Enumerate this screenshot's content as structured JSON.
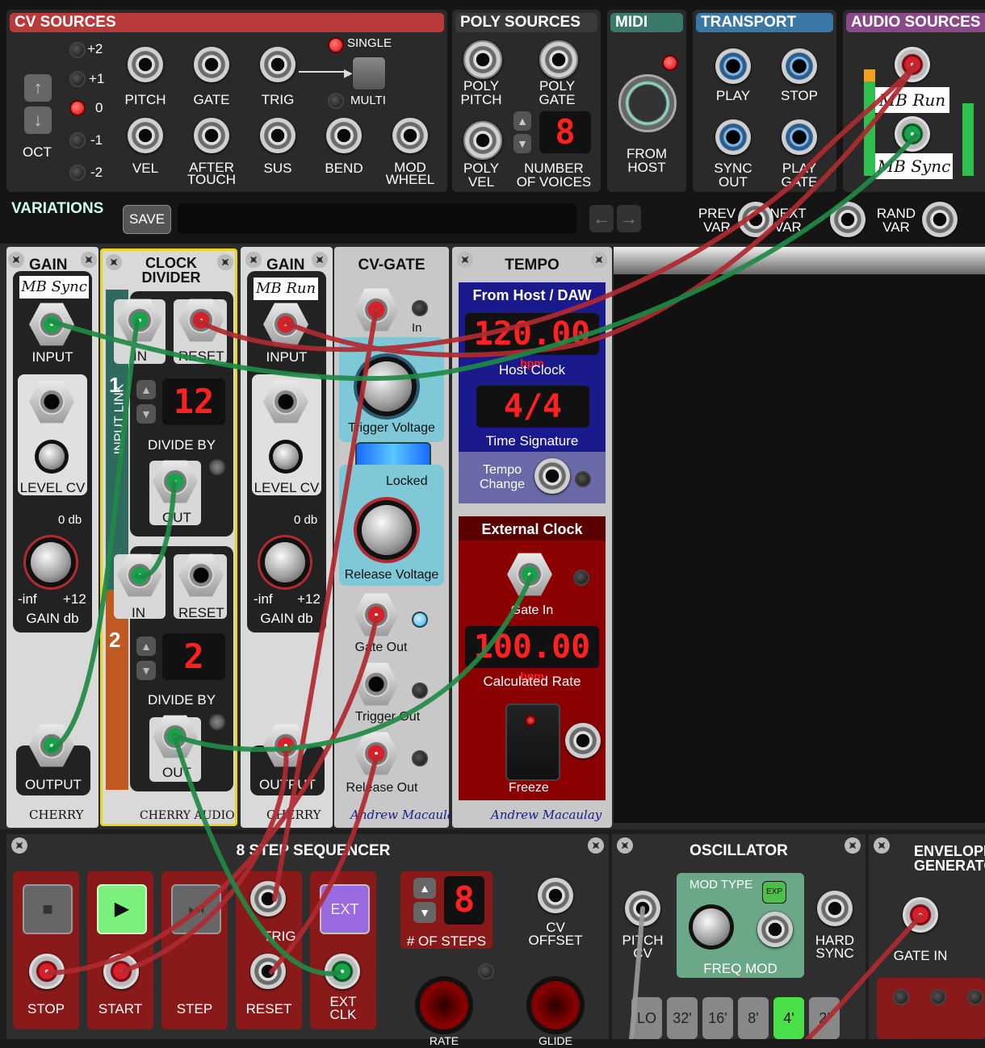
{
  "top_bar": {
    "cv_sources": {
      "title": "CV SOURCES",
      "oct_label": "OCT",
      "oct_levels": [
        "+2",
        "+1",
        "0",
        "-1",
        "-2"
      ],
      "jacks_row1": [
        "PITCH",
        "GATE",
        "TRIG"
      ],
      "jacks_row2": [
        "VEL",
        "AFTER\nTOUCH",
        "SUS",
        "BEND",
        "MOD\nWHEEL"
      ],
      "single_label": "SINGLE",
      "multi_label": "MULTI"
    },
    "poly_sources": {
      "title": "POLY SOURCES",
      "poly_pitch": "POLY\nPITCH",
      "poly_gate": "POLY\nGATE",
      "poly_vel": "POLY\nVEL",
      "voices_label": "NUMBER\nOF VOICES",
      "voices_value": "8"
    },
    "midi": {
      "title": "MIDI",
      "from_host": "FROM\nHOST"
    },
    "transport": {
      "title": "TRANSPORT",
      "play": "PLAY",
      "stop": "STOP",
      "sync_out": "SYNC\nOUT",
      "play_gate": "PLAY\nGATE"
    },
    "audio_sources": {
      "title": "AUDIO SOURCES",
      "tag1": "MB Run",
      "tag2": "MB Sync"
    },
    "variations": {
      "title": "VARIATIONS",
      "save_label": "SAVE",
      "prev": "PREV\nVAR",
      "next": "NEXT\nVAR",
      "rand": "RAND\nVAR"
    }
  },
  "gain1": {
    "title": "GAIN",
    "tag": "MB Sync",
    "input": "INPUT",
    "level_cv": "LEVEL CV",
    "zero_db": "0 db",
    "min": "-inf",
    "max": "+12",
    "gain_label": "GAIN db",
    "output": "OUTPUT",
    "brand": "CHERRY"
  },
  "clock_divider": {
    "title": "CLOCK\nDIVIDER",
    "input_link": "INPUT LINK",
    "sec1": {
      "num": "1",
      "in": "IN",
      "reset": "RESET",
      "value": "12",
      "divide_by": "DIVIDE BY",
      "out": "OUT"
    },
    "sec2": {
      "num": "2",
      "in": "IN",
      "reset": "RESET",
      "value": "2",
      "divide_by": "DIVIDE BY",
      "out": "OUT"
    },
    "brand": "CHERRY AUDIO"
  },
  "gain2": {
    "title": "GAIN",
    "tag": "MB Run",
    "input": "INPUT",
    "level_cv": "LEVEL CV",
    "zero_db": "0 db",
    "min": "-inf",
    "max": "+12",
    "gain_label": "GAIN db",
    "output": "OUTPUT",
    "brand": "CHERRY"
  },
  "cv_gate": {
    "title": "CV-GATE",
    "in": "In",
    "trigger_voltage": "Trigger Voltage",
    "locked": "Locked",
    "release_voltage": "Release Voltage",
    "gate_out": "Gate Out",
    "trigger_out": "Trigger Out",
    "release_out": "Release Out",
    "author": "Andrew Macaulay"
  },
  "tempo": {
    "title": "TEMPO",
    "from_host": "From Host / DAW",
    "host_bpm": "120.00",
    "bpm_unit": "bpm",
    "host_clock": "Host Clock",
    "time_sig": "4/4",
    "time_sig_label": "Time Signature",
    "tempo_change": "Tempo\nChange",
    "external_clock": "External Clock",
    "gate_in": "Gate In",
    "calc_bpm": "100.00",
    "calc_rate": "Calculated Rate",
    "freeze": "Freeze",
    "author": "Andrew Macaulay"
  },
  "sequencer": {
    "title": "8 STEP SEQUENCER",
    "stop": "STOP",
    "start": "START",
    "step": "STEP",
    "reset": "RESET",
    "trig": "TRIG",
    "ext": "EXT",
    "ext_clk": "EXT\nCLK",
    "steps_value": "8",
    "steps_label": "# OF STEPS",
    "cv_offset": "CV\nOFFSET",
    "rate": "RATE",
    "glide": "GLIDE"
  },
  "oscillator": {
    "title": "OSCILLATOR",
    "pitch_cv": "PITCH\nCV",
    "mod_type": "MOD TYPE",
    "exp": "EXP",
    "freq_mod": "FREQ MOD",
    "hard_sync": "HARD\nSYNC",
    "ranges": [
      "LO",
      "32'",
      "16'",
      "8'",
      "4'",
      "2'"
    ],
    "active_range": "4'"
  },
  "envelope": {
    "title": "ENVELOPE\nGENERATOR",
    "gate_in": "GATE IN"
  },
  "colors": {
    "cable_red": "#b02a30",
    "cable_green": "#1f8a45",
    "accent_red": "#c0392b",
    "tempo_blue": "#1a1a8c",
    "tempo_red": "#8b0000"
  }
}
